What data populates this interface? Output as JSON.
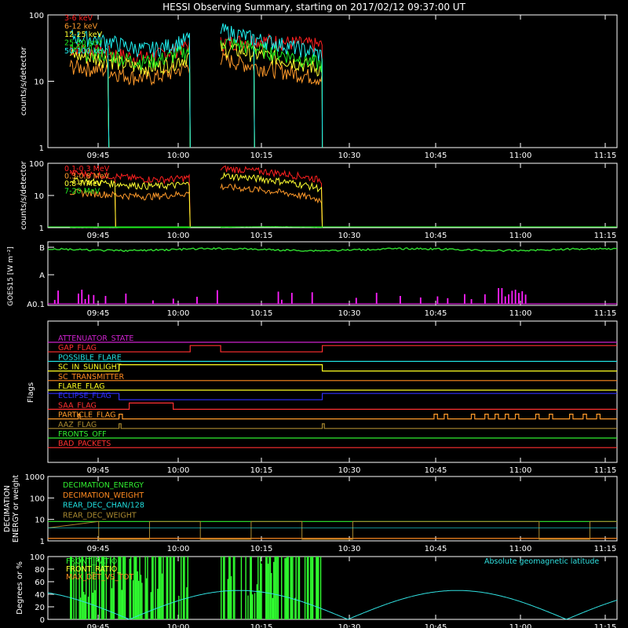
{
  "title": "HESSI Observing Summary, starting on 2017/02/12 09:37:00 UT",
  "time_ticks": [
    "09:45",
    "10:00",
    "10:15",
    "10:30",
    "10:45",
    "11:00",
    "11:15"
  ],
  "chart_data": [
    {
      "type": "line",
      "panel": "count-rates",
      "ylabel": "counts/s/detector",
      "yscale": "log",
      "ylim": [
        1,
        100
      ],
      "y_ticks": [
        "1",
        "10",
        "100"
      ],
      "legend_placement": "top-left",
      "series": [
        {
          "name": "3-6 keV",
          "color": "#ff2020"
        },
        {
          "name": "6-12 keV",
          "color": "#ff9a2a"
        },
        {
          "name": "12-25 keV",
          "color": "#ffff30"
        },
        {
          "name": "25-50 keV",
          "color": "#20ee20"
        },
        {
          "name": "50-100 keV",
          "color": "#20f0f0"
        }
      ]
    },
    {
      "type": "line",
      "panel": "high-energy-rates",
      "ylabel": "counts/s/detector",
      "yscale": "log",
      "ylim": [
        1,
        100
      ],
      "y_ticks": [
        "1",
        "10",
        "100"
      ],
      "legend_placement": "top-left",
      "series": [
        {
          "name": "0.1-0.3 MeV",
          "color": "#ff2020"
        },
        {
          "name": "0.3-0.8 MeV",
          "color": "#ff9a2a"
        },
        {
          "name": "0.8-7 MeV",
          "color": "#ffff30"
        },
        {
          "name": "7-20 MeV",
          "color": "#20ee20"
        }
      ]
    },
    {
      "type": "line",
      "panel": "goes",
      "ylabel": "GOES15 [W m⁻²]",
      "y_ticks": [
        "A0.1",
        "A",
        "B"
      ],
      "series": [
        {
          "color": "#30dd30"
        },
        {
          "color": "#ff20ff"
        }
      ]
    },
    {
      "type": "line",
      "panel": "flags",
      "ylabel": "Flags",
      "flags": [
        {
          "name": "ATTENUATOR_STATE",
          "color": "#cc22cc"
        },
        {
          "name": "GAP_FLAG",
          "color": "#ff3030"
        },
        {
          "name": "POSSIBLE_FLARE",
          "color": "#20e0e0"
        },
        {
          "name": "SC_IN_SUNLIGHT",
          "color": "#ffff20"
        },
        {
          "name": "SC_TRANSMITTER",
          "color": "#ff8a20"
        },
        {
          "name": "FLARE_FLAG",
          "color": "#ffff20"
        },
        {
          "name": "ECLIPSE_FLAG",
          "color": "#3030ff"
        },
        {
          "name": "SAA_FLAG",
          "color": "#ff3030"
        },
        {
          "name": "PARTICLE_FLAG",
          "color": "#ff9a2a"
        },
        {
          "name": "AAZ_FLAG",
          "color": "#aa8a30"
        },
        {
          "name": "FRONTS_OFF",
          "color": "#30ee30"
        },
        {
          "name": "BAD_PACKETS",
          "color": "#ff3030"
        }
      ]
    },
    {
      "type": "line",
      "panel": "decimation",
      "ylabel": "DECIMATION ENERGY or weight",
      "yscale": "log",
      "ylim": [
        1,
        1000
      ],
      "y_ticks": [
        "1",
        "10",
        "100",
        "1000"
      ],
      "legend_placement": "top-left",
      "series": [
        {
          "name": "DECIMATION_ENERGY",
          "color": "#30ee30"
        },
        {
          "name": "DECIMATION_WEIGHT",
          "color": "#ff8a20"
        },
        {
          "name": "REAR_DEC_CHAN/128",
          "color": "#20e0e0"
        },
        {
          "name": "REAR_DEC_WEIGHT",
          "color": "#aa8a30"
        }
      ]
    },
    {
      "type": "line",
      "panel": "ratios",
      "ylabel": "Degrees or %",
      "ylim": [
        0,
        100
      ],
      "y_ticks": [
        "0",
        "20",
        "40",
        "60",
        "80",
        "100"
      ],
      "legend_placement": "top-left",
      "series": [
        {
          "name": "FRONT_RATIO",
          "color": "#30ff30"
        },
        {
          "name": "FRONT_RATIO_",
          "color": "#ffff30"
        },
        {
          "name": "MAX_DET_VS_TOT",
          "color": "#ff8a20"
        },
        {
          "name": "Absolute geomagnetic latitude",
          "color": "#30e0e0"
        }
      ]
    }
  ]
}
